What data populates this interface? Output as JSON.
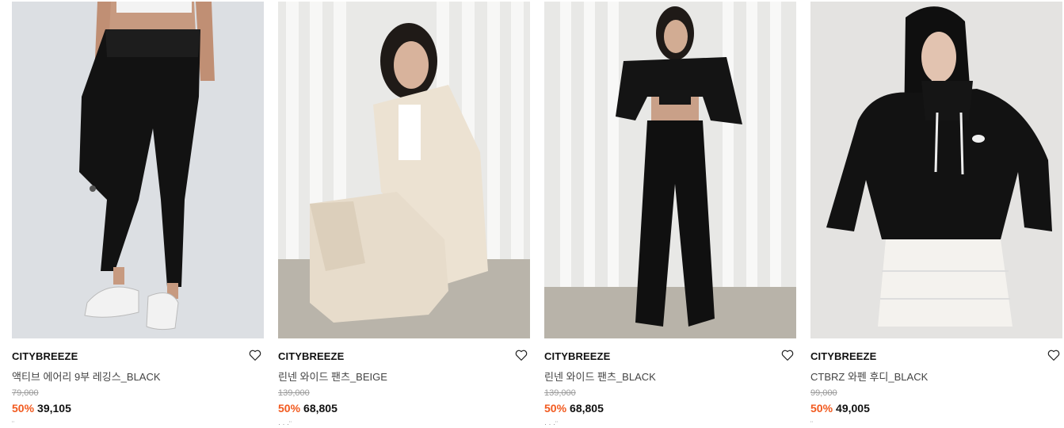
{
  "products": [
    {
      "brand": "CITYBREEZE",
      "name": "액티브 에어리 9부 레깅스_BLACK",
      "original_price": "79,000",
      "discount": "50%",
      "sale_price": "39,105",
      "image": "model-in-black-leggings",
      "wishlist_icon": "heart-outline-icon"
    },
    {
      "brand": "CITYBREEZE",
      "name": "린넨 와이드 팬츠_BEIGE",
      "original_price": "139,000",
      "discount": "50%",
      "sale_price": "68,805",
      "image": "model-in-beige-linen-suit",
      "wishlist_icon": "heart-outline-icon"
    },
    {
      "brand": "CITYBREEZE",
      "name": "린넨 와이드 팬츠_BLACK",
      "original_price": "139,000",
      "discount": "50%",
      "sale_price": "68,805",
      "image": "model-in-black-linen-set",
      "wishlist_icon": "heart-outline-icon"
    },
    {
      "brand": "CITYBREEZE",
      "name": "CTBRZ 와펜 후디_BLACK",
      "original_price": "99,000",
      "discount": "50%",
      "sale_price": "49,005",
      "image": "model-in-black-hoodie",
      "wishlist_icon": "heart-outline-icon"
    }
  ],
  "colors": {
    "discount": "#f25a1f",
    "original_price": "#9a9a9a",
    "brand": "#111111"
  }
}
